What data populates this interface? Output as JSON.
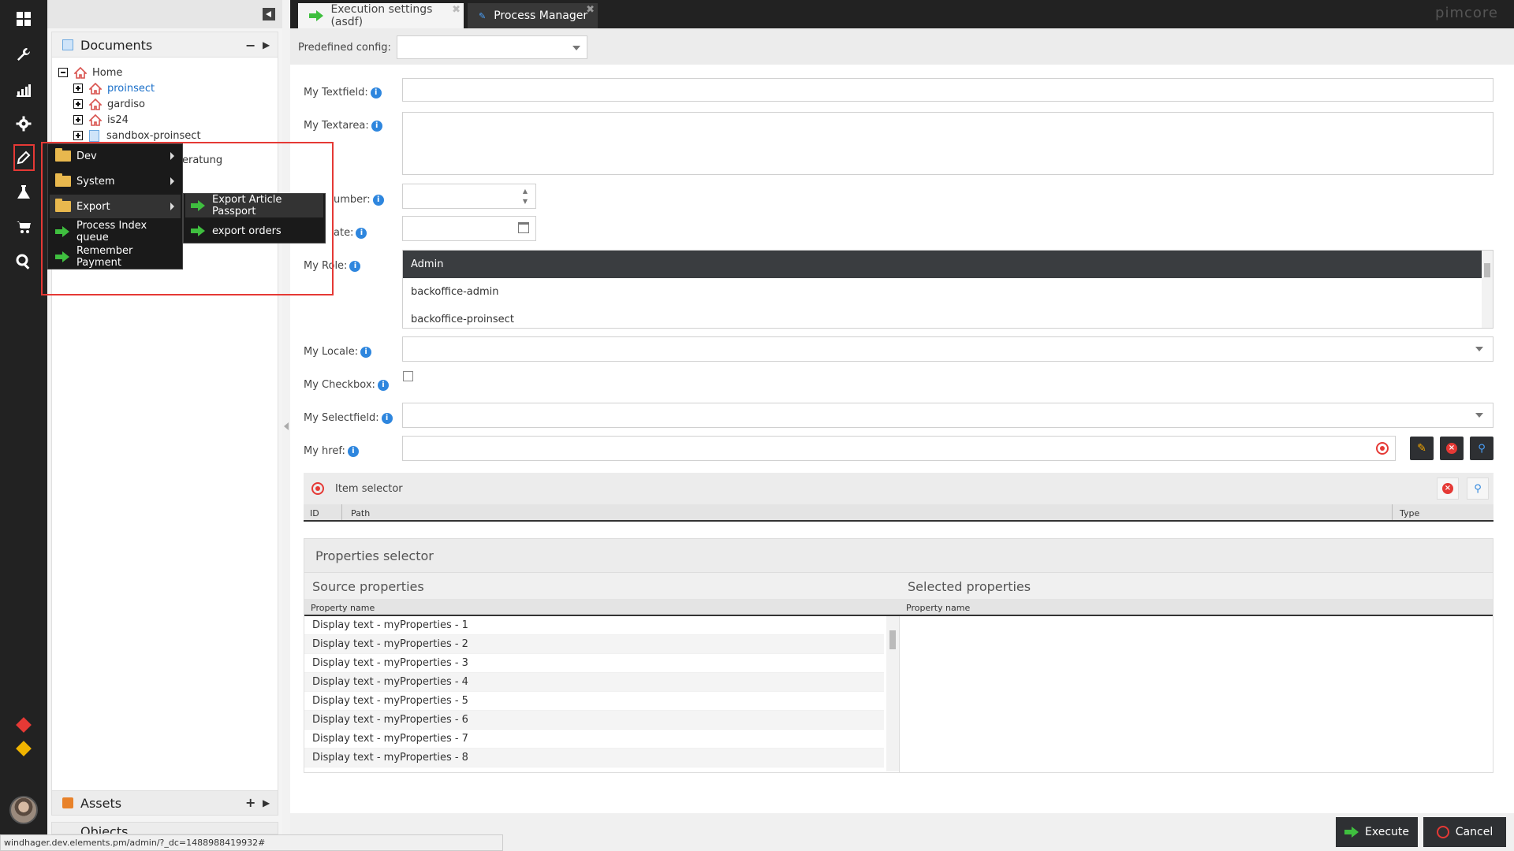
{
  "tabs": [
    {
      "label": "Execution settings (asdf)",
      "close": "✖"
    },
    {
      "label": "Process Manager",
      "close": "✖"
    }
  ],
  "brand": "pimcore",
  "tree": {
    "documents_title": "Documents",
    "items": [
      "Home",
      "proinsect",
      "gardiso",
      "is24",
      "sandbox-proinsect",
      "eratung"
    ],
    "assets_title": "Assets",
    "objects_title": "Objects"
  },
  "context_menu": {
    "items": [
      "Dev",
      "System",
      "Export",
      "Process Index queue",
      "Remember Payment"
    ],
    "submenu": [
      "Export Article Passport",
      "export orders"
    ]
  },
  "form": {
    "predefined_label": "Predefined config:",
    "predefined_value": "",
    "textfield_label": "My Textfield:",
    "textfield_value": "",
    "textarea_label": "My Textarea:",
    "number_label": "umber:",
    "date_label": "ate:",
    "role_label": "My Role:",
    "roles": [
      "Admin",
      "backoffice-admin",
      "backoffice-proinsect"
    ],
    "locale_label": "My Locale:",
    "checkbox_label": "My Checkbox:",
    "checkbox_checked": false,
    "selectfield_label": "My Selectfield:",
    "href_label": "My href:"
  },
  "item_selector": {
    "title": "Item selector",
    "columns": [
      "ID",
      "Path",
      "Type"
    ]
  },
  "properties_selector": {
    "title": "Properties selector",
    "source_title": "Source properties",
    "selected_title": "Selected properties",
    "column": "Property name",
    "source_items": [
      "Display text - myProperties - 1",
      "Display text - myProperties - 2",
      "Display text - myProperties - 3",
      "Display text - myProperties - 4",
      "Display text - myProperties - 5",
      "Display text - myProperties - 6",
      "Display text - myProperties - 7",
      "Display text - myProperties - 8"
    ]
  },
  "buttons": {
    "execute": "Execute",
    "cancel": "Cancel"
  },
  "status_url": "windhager.dev.elements.pm/admin/?_dc=1488988419932#",
  "icons": [
    "grid-icon",
    "wrench-icon",
    "chart-icon",
    "gear-icon",
    "pen-icon",
    "flask-icon",
    "cart-icon",
    "search-icon",
    "warning-icon",
    "notification-icon"
  ],
  "colors": {
    "highlight": "#e53935",
    "accent_blue": "#2e86de",
    "green_arrow": "#3fbf3f"
  }
}
